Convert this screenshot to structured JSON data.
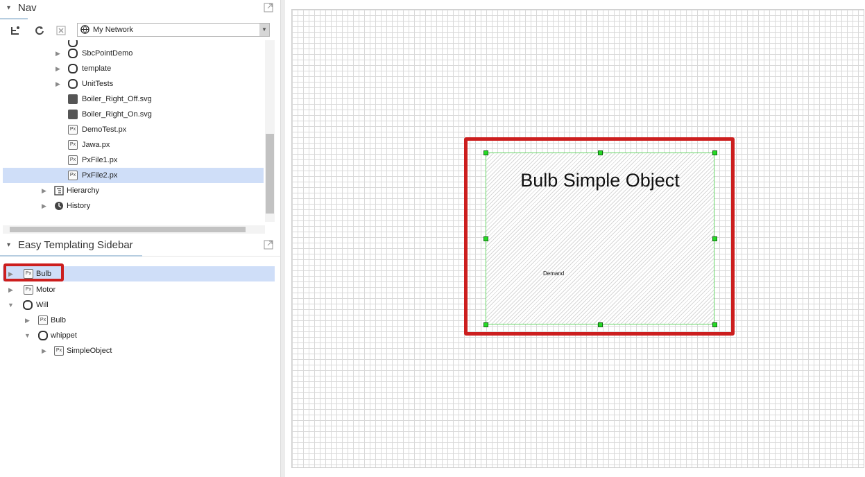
{
  "nav": {
    "title": "Nav",
    "network_select": "My Network",
    "tree": [
      {
        "label": "SbcPointDemo",
        "type": "folder",
        "expandable": true
      },
      {
        "label": "template",
        "type": "folder",
        "expandable": true
      },
      {
        "label": "UnitTests",
        "type": "folder",
        "expandable": true
      },
      {
        "label": "Boiler_Right_Off.svg",
        "type": "image",
        "expandable": false
      },
      {
        "label": "Boiler_Right_On.svg",
        "type": "image",
        "expandable": false
      },
      {
        "label": "DemoTest.px",
        "type": "px",
        "expandable": false
      },
      {
        "label": "Jawa.px",
        "type": "px",
        "expandable": false
      },
      {
        "label": "PxFile1.px",
        "type": "px",
        "expandable": false
      },
      {
        "label": "PxFile2.px",
        "type": "px",
        "expandable": false,
        "selected": true
      },
      {
        "label": "Hierarchy",
        "type": "hierarchy",
        "expandable": true
      },
      {
        "label": "History",
        "type": "history",
        "expandable": true
      }
    ]
  },
  "sidebar": {
    "title": "Easy Templating Sidebar",
    "tree": [
      {
        "label": "Bulb",
        "type": "px",
        "expandable": true,
        "selected": true
      },
      {
        "label": "Motor",
        "type": "px",
        "expandable": true
      },
      {
        "label": "Will",
        "type": "folder",
        "expanded": true
      },
      {
        "label": "Bulb",
        "type": "px",
        "expandable": true
      },
      {
        "label": "whippet",
        "type": "folder",
        "expanded": true
      },
      {
        "label": "SimpleObject",
        "type": "px",
        "expandable": true
      }
    ],
    "px_badge": "Px"
  },
  "canvas": {
    "object_title": "Bulb Simple Object",
    "object_label": "Demand"
  },
  "colors": {
    "highlight": "#cc1e1e",
    "selection": "#cfdef8",
    "handle": "#24d924"
  }
}
